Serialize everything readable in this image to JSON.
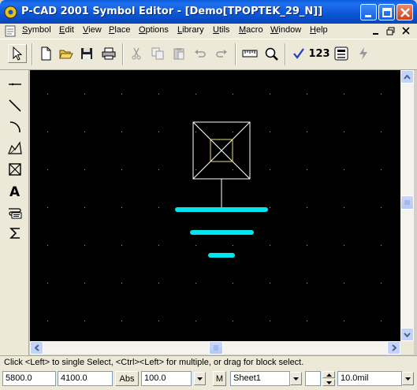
{
  "window": {
    "title": "P-CAD 2001 Symbol Editor - [Demo[TPOPTEK_29_N]]"
  },
  "menu": {
    "items": [
      {
        "u": "S",
        "rest": "ymbol"
      },
      {
        "u": "E",
        "rest": "dit"
      },
      {
        "u": "V",
        "rest": "iew"
      },
      {
        "u": "P",
        "rest": "lace"
      },
      {
        "u": "O",
        "rest": "ptions"
      },
      {
        "u": "L",
        "rest": "ibrary"
      },
      {
        "u": "U",
        "rest": "tils"
      },
      {
        "u": "M",
        "rest": "acro"
      },
      {
        "u": "W",
        "rest": "indow"
      },
      {
        "u": "H",
        "rest": "elp"
      }
    ]
  },
  "toolbar": {
    "numbering_label": "123"
  },
  "status": {
    "hint": "Click <Left> to single Select, <Ctrl><Left> for multiple, or drag for block select.",
    "x_coord": "5800.0",
    "y_coord": "4100.0",
    "abs_label": "Abs",
    "zoom": "100.0",
    "m_label": "M",
    "sheet": "Sheet1",
    "grid": "10.0mil"
  },
  "colors": {
    "ground_symbol": "#00e5ee",
    "line": "#ffffff",
    "pin_box": "#e8e07a"
  }
}
